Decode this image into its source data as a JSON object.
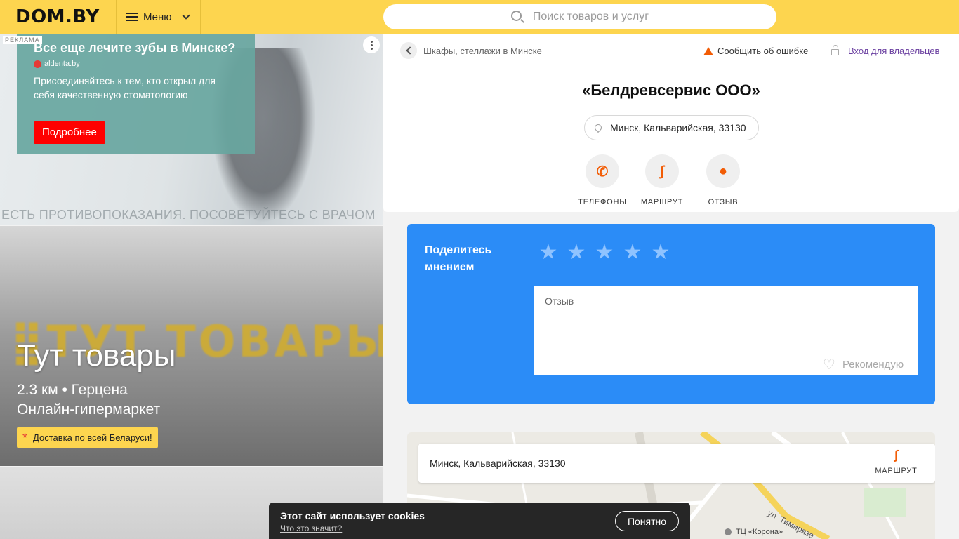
{
  "header": {
    "logo": "DOM.BY",
    "menu_label": "Меню",
    "search_placeholder": "Поиск товаров и услуг"
  },
  "ad": {
    "label": "РЕКЛАМА",
    "title": "Все еще лечите зубы в Минске?",
    "source": "aldenta.by",
    "text": "Присоединяйтесь к тем, кто открыл для себя качественную стоматологию",
    "button": "Подробнее",
    "warning": "ЕСТЬ ПРОТИВОПОКАЗАНИЯ. ПОСОВЕТУЙТЕСЬ С ВРАЧОМ"
  },
  "promo": {
    "logo_text": "⣿ТУТ ТОВАРЫ",
    "title": "Тут товары",
    "line1": "2.3 км • Герцена",
    "line2": "Онлайн-гипермаркет",
    "badge": "Доставка по всей Беларуси!"
  },
  "card": {
    "breadcrumb": "Шкафы, стеллажи в Минске",
    "report": "Сообщить об ошибке",
    "owners": "Вход для владельцев",
    "company": "«Белдревсервис ООО»",
    "address": "Минск, Кальварийская, 33130",
    "actions": [
      {
        "label": "ТЕЛЕФОНЫ",
        "icon": "phone-icon"
      },
      {
        "label": "МАРШРУТ",
        "icon": "route-icon"
      },
      {
        "label": "ОТЗЫВ",
        "icon": "chat-icon"
      }
    ]
  },
  "review": {
    "title": "Поделитесь мнением",
    "stars_total": 5,
    "placeholder": "Отзыв",
    "recommend": "Рекомендую"
  },
  "map": {
    "address": "Минск, Кальварийская, 33130",
    "route_label": "МАРШРУТ",
    "poi": "ТЦ «Корона»",
    "street": "ул. Тимирязе"
  },
  "cookie": {
    "text": "Этот сайт использует cookies",
    "link": "Что это значит?",
    "button": "Понятно"
  },
  "colors": {
    "header_bg": "#fdd54f",
    "review_bg": "#2b8cf7",
    "accent_orange": "#f25c05",
    "owner_link": "#6a3fa0"
  }
}
